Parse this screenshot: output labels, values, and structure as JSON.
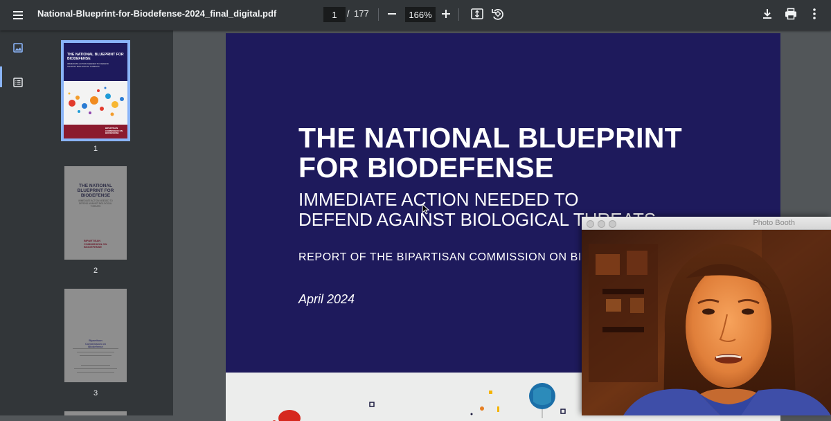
{
  "toolbar": {
    "filename": "National-Blueprint-for-Biodefense-2024_final_digital.pdf",
    "current_page": "1",
    "page_separator": "/",
    "total_pages": "177",
    "zoom": "166%"
  },
  "sidebar": {
    "thumbnails": [
      {
        "number": "1",
        "title": "THE NATIONAL BLUEPRINT FOR BIODEFENSE",
        "subtitle": "IMMEDIATE ACTION NEEDED TO DEFEND AGAINST BIOLOGICAL THREATS",
        "logo": "BIPARTISAN COMMISSION ON BIODEFENSE"
      },
      {
        "number": "2",
        "title": "THE NATIONAL BLUEPRINT FOR BIODEFENSE",
        "subtitle": "IMMEDIATE ACTION NEEDED TO DEFEND AGAINST BIOLOGICAL THREATS",
        "logo": "BIPARTISAN COMMISSION ON BIODEFENSE"
      },
      {
        "number": "3",
        "logo": "Bipartisan Commission on Biodefense"
      }
    ]
  },
  "document": {
    "title_line1": "THE NATIONAL BLUEPRINT",
    "title_line2": "FOR BIODEFENSE",
    "subtitle_line1": "IMMEDIATE ACTION NEEDED TO",
    "subtitle_line2": "DEFEND AGAINST BIOLOGICAL THREATS",
    "report_line": "REPORT OF THE BIPARTISAN COMMISSION ON BIODEFENSE",
    "date": "April 2024"
  },
  "photo_booth": {
    "title": "Photo Booth"
  },
  "colors": {
    "toolbar_bg": "#323639",
    "viewer_bg": "#525659",
    "cover_navy": "#1e1a5c",
    "cover_maroon": "#8b1a2e",
    "active_blue": "#8ab4f8"
  }
}
